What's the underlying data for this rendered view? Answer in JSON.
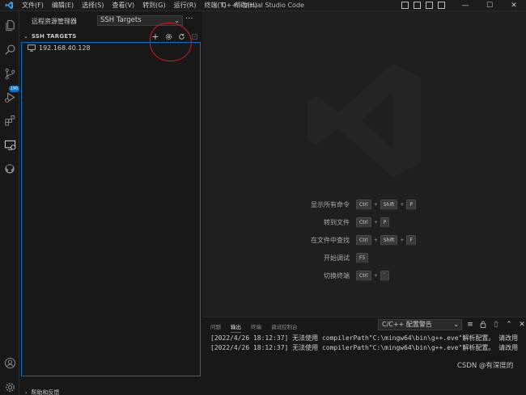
{
  "titlebar": {
    "menu": [
      "文件(F)",
      "编辑(E)",
      "选择(S)",
      "查看(V)",
      "转到(G)",
      "运行(R)",
      "终端(T)",
      "帮助(H)"
    ],
    "window_title": "C++ - Visual Studio Code",
    "controls": {
      "minimize": "—",
      "maximize": "☐",
      "close": "✕"
    }
  },
  "activity": {
    "source_control_badge": "190"
  },
  "sidebar": {
    "title": "远程资源管理器",
    "target_select": "SSH Targets",
    "more": "···",
    "section_title": "SSH TARGETS",
    "hosts": [
      "192.168.40.128"
    ],
    "bottom_section": "帮助和反馈"
  },
  "editor": {
    "shortcuts": [
      {
        "label": "显示所有命令",
        "keys": [
          "Ctrl",
          "Shift",
          "P"
        ]
      },
      {
        "label": "转到文件",
        "keys": [
          "Ctrl",
          "P"
        ]
      },
      {
        "label": "在文件中查找",
        "keys": [
          "Ctrl",
          "Shift",
          "F"
        ]
      },
      {
        "label": "开始调试",
        "keys": [
          "F5"
        ]
      },
      {
        "label": "切换终端",
        "keys": [
          "Ctrl",
          "`"
        ]
      }
    ]
  },
  "panel": {
    "tabs": [
      "问题",
      "输出",
      "终端",
      "调试控制台"
    ],
    "active_tab": "输出",
    "channel": "C/C++ 配置警告",
    "output_lines": [
      "[2022/4/26 18:12:37] 无法使用 compilerPath\"C:\\mingw64\\bin\\g++.eve\"解析配置。 请改用",
      "[2022/4/26 18:12:37] 无法使用 compilerPath\"C:\\mingw64\\bin\\g++.eve\"解析配置。 请改用"
    ]
  },
  "credit": "CSDN @有深度的",
  "colors": {
    "accent": "#0078d4",
    "annotation": "#d21b1b",
    "frame": "#0e6cc4"
  }
}
